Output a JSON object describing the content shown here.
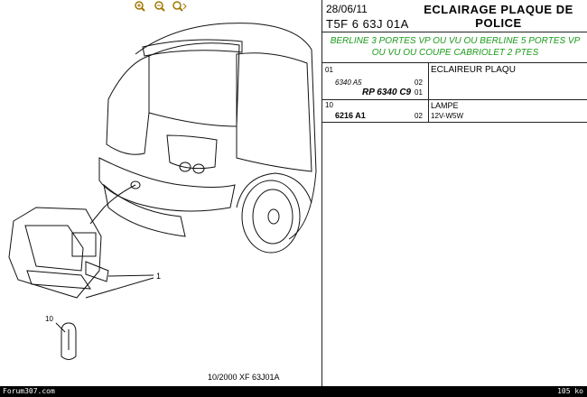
{
  "header": {
    "date": "28/06/11",
    "ref_code": "T5F 6 63J 01A",
    "title_line1": "ECLAIRAGE PLAQUE DE",
    "title_line2": "POLICE"
  },
  "models_text": "BERLINE 3 PORTES VP OU VU OU BERLINE 5 PORTES VP OU VU OU COUPE CABRIOLET 2 PTES",
  "parts": [
    {
      "index": "01",
      "sub_ref": "6340 A5",
      "part_number": "RP 6340 C9",
      "qty_top": "02",
      "qty_bottom": "01",
      "description": "ECLAIREUR PLAQU"
    },
    {
      "index": "10",
      "part_number": "6216 A1",
      "qty": "02",
      "description": "LAMPE",
      "spec": "12V-W5W"
    }
  ],
  "diagram": {
    "callout_1": "1",
    "callout_10": "10",
    "footer": "10/2000   XF 63J01A"
  },
  "status_bar": {
    "site": "Forum307.com",
    "size": "105 ko"
  },
  "toolbar": {
    "icons": [
      "zoom-in-icon",
      "zoom-out-icon",
      "zoom-fit-icon"
    ]
  },
  "colors": {
    "models_text": "#1a9a1a",
    "status_bar_bg": "#000000"
  }
}
